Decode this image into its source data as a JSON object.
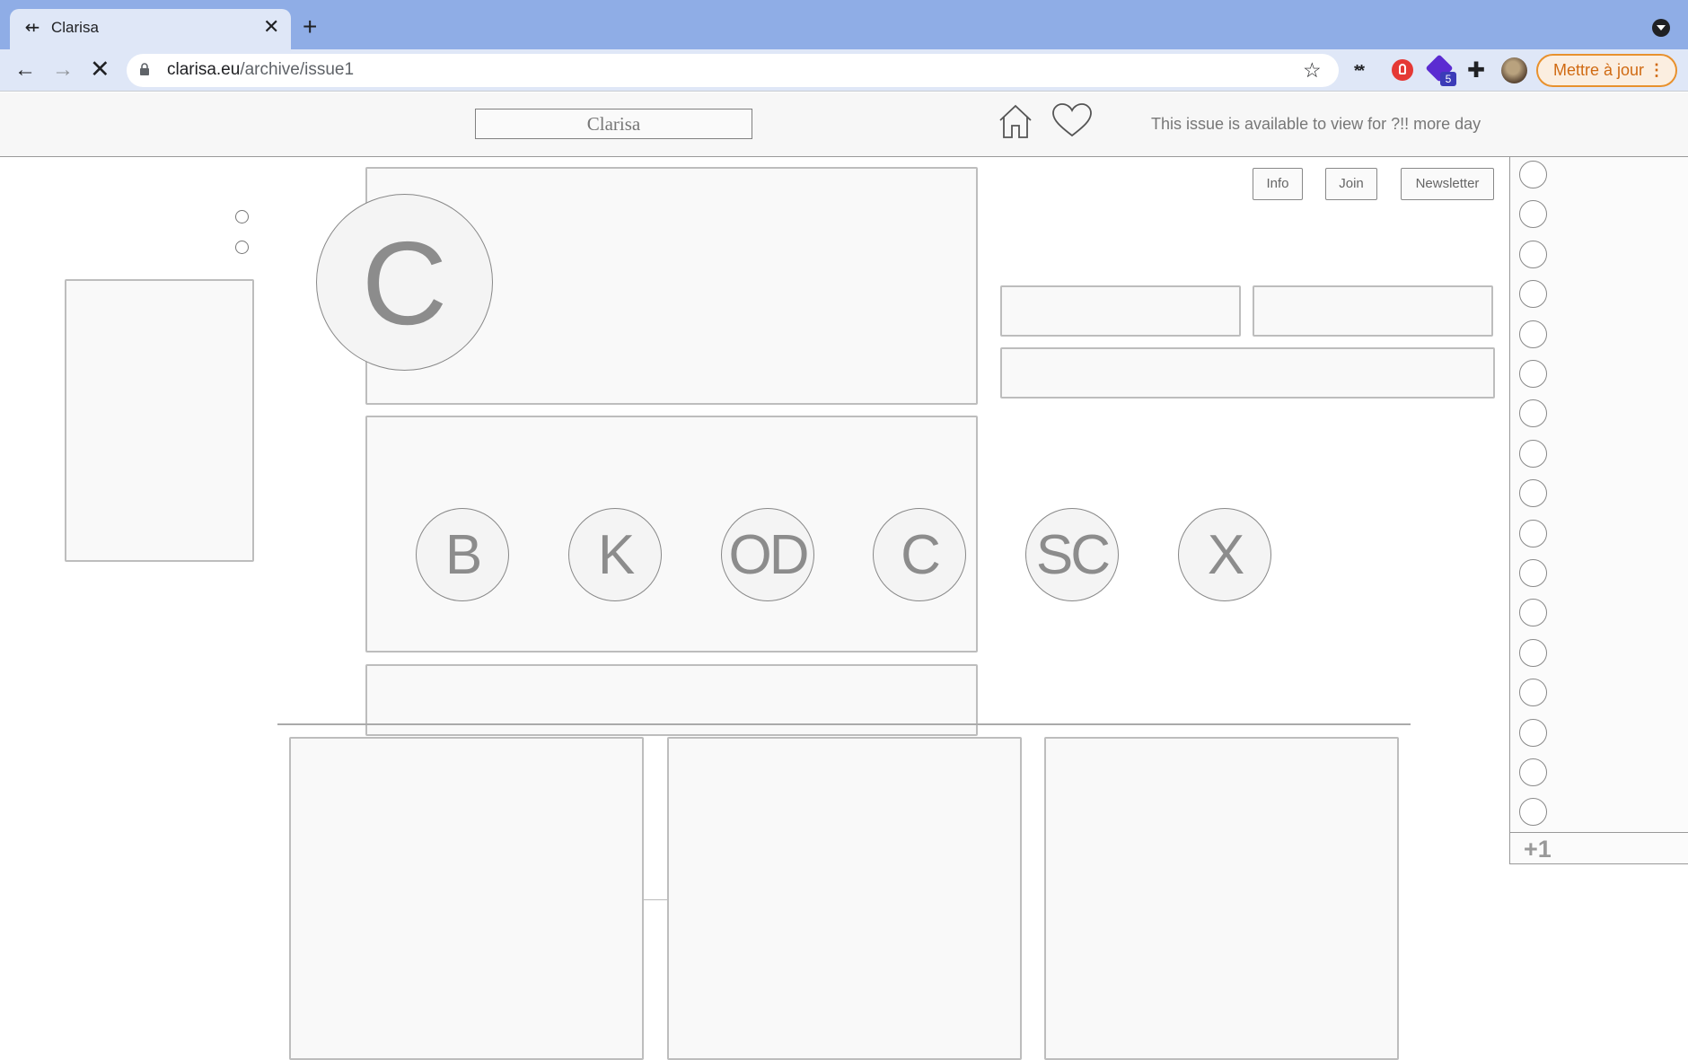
{
  "browser": {
    "tab_title": "Clarisa",
    "tab_close": "✕",
    "new_tab": "+",
    "url_host": "clarisa.eu",
    "url_path": "/archive/issue1",
    "ext_badge": "5",
    "update_label": "Mettre à jour"
  },
  "header": {
    "site_title": "Clarisa",
    "availability": "This issue is available to view for ?!! more day"
  },
  "nav_buttons": {
    "info": "Info",
    "join": "Join",
    "newsletter": "Newsletter"
  },
  "hero": {
    "logo_letter": "C"
  },
  "categories": [
    "B",
    "K",
    "OD",
    "C",
    "SC",
    "X"
  ],
  "sidebar": {
    "more_count": "+1"
  }
}
